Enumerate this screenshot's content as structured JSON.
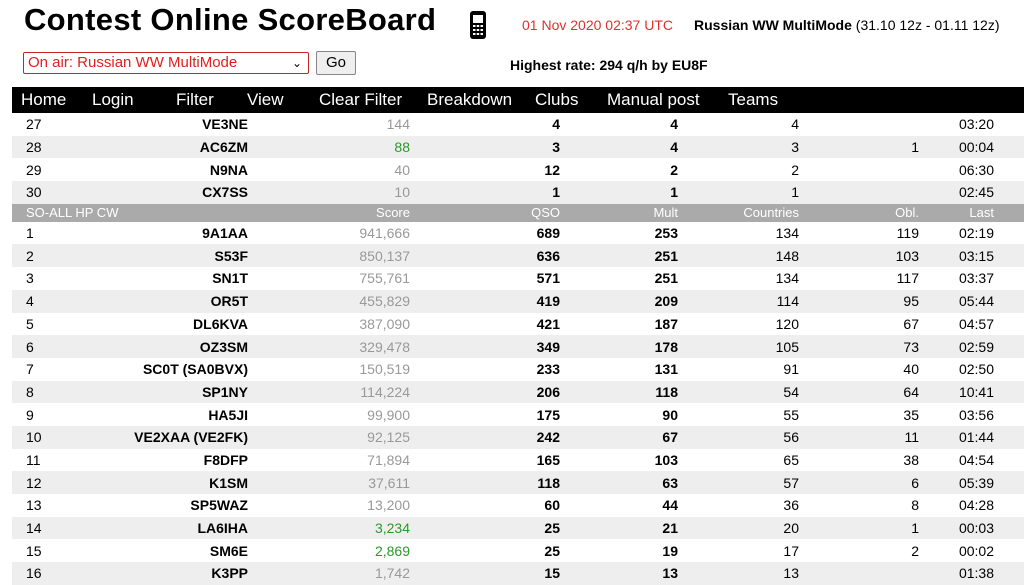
{
  "header": {
    "title": "Contest Online ScoreBoard",
    "datetime": "01 Nov 2020 02:37 UTC",
    "contest_name": "Russian WW MultiMode",
    "contest_period": " (31.10 12z - 01.11 12z)",
    "select_value": "On air: Russian WW MultiMode",
    "go_label": "Go",
    "highest_rate": "Highest rate: 294 q/h by EU8F"
  },
  "nav": [
    "Home",
    "Login",
    "Filter",
    "View",
    "Clear Filter",
    "Breakdown",
    "Clubs",
    "Manual post",
    "Teams"
  ],
  "top_rows": [
    {
      "rank": "27",
      "call": "VE3NE",
      "score": "144",
      "qso": "4",
      "mult": "4",
      "countries": "4",
      "obl": "",
      "last": "03:20",
      "green": false
    },
    {
      "rank": "28",
      "call": "AC6ZM",
      "score": "88",
      "qso": "3",
      "mult": "4",
      "countries": "3",
      "obl": "1",
      "last": "00:04",
      "green": true
    },
    {
      "rank": "29",
      "call": "N9NA",
      "score": "40",
      "qso": "12",
      "mult": "2",
      "countries": "2",
      "obl": "",
      "last": "06:30",
      "green": false
    },
    {
      "rank": "30",
      "call": "CX7SS",
      "score": "10",
      "qso": "1",
      "mult": "1",
      "countries": "1",
      "obl": "",
      "last": "02:45",
      "green": false
    }
  ],
  "section": {
    "category": "SO-ALL HP CW",
    "col_score": "Score",
    "col_qso": "QSO",
    "col_mult": "Mult",
    "col_countries": "Countries",
    "col_obl": "Obl.",
    "col_last": "Last"
  },
  "rows": [
    {
      "rank": "1",
      "call": "9A1AA",
      "score": "941,666",
      "qso": "689",
      "mult": "253",
      "countries": "134",
      "obl": "119",
      "last": "02:19",
      "green": false
    },
    {
      "rank": "2",
      "call": "S53F",
      "score": "850,137",
      "qso": "636",
      "mult": "251",
      "countries": "148",
      "obl": "103",
      "last": "03:15",
      "green": false
    },
    {
      "rank": "3",
      "call": "SN1T",
      "score": "755,761",
      "qso": "571",
      "mult": "251",
      "countries": "134",
      "obl": "117",
      "last": "03:37",
      "green": false
    },
    {
      "rank": "4",
      "call": "OR5T",
      "score": "455,829",
      "qso": "419",
      "mult": "209",
      "countries": "114",
      "obl": "95",
      "last": "05:44",
      "green": false
    },
    {
      "rank": "5",
      "call": "DL6KVA",
      "score": "387,090",
      "qso": "421",
      "mult": "187",
      "countries": "120",
      "obl": "67",
      "last": "04:57",
      "green": false
    },
    {
      "rank": "6",
      "call": "OZ3SM",
      "score": "329,478",
      "qso": "349",
      "mult": "178",
      "countries": "105",
      "obl": "73",
      "last": "02:59",
      "green": false
    },
    {
      "rank": "7",
      "call": "SC0T (SA0BVX)",
      "score": "150,519",
      "qso": "233",
      "mult": "131",
      "countries": "91",
      "obl": "40",
      "last": "02:50",
      "green": false
    },
    {
      "rank": "8",
      "call": "SP1NY",
      "score": "114,224",
      "qso": "206",
      "mult": "118",
      "countries": "54",
      "obl": "64",
      "last": "10:41",
      "green": false
    },
    {
      "rank": "9",
      "call": "HA5JI",
      "score": "99,900",
      "qso": "175",
      "mult": "90",
      "countries": "55",
      "obl": "35",
      "last": "03:56",
      "green": false
    },
    {
      "rank": "10",
      "call": "VE2XAA (VE2FK)",
      "score": "92,125",
      "qso": "242",
      "mult": "67",
      "countries": "56",
      "obl": "11",
      "last": "01:44",
      "green": false
    },
    {
      "rank": "11",
      "call": "F8DFP",
      "score": "71,894",
      "qso": "165",
      "mult": "103",
      "countries": "65",
      "obl": "38",
      "last": "04:54",
      "green": false
    },
    {
      "rank": "12",
      "call": "K1SM",
      "score": "37,611",
      "qso": "118",
      "mult": "63",
      "countries": "57",
      "obl": "6",
      "last": "05:39",
      "green": false
    },
    {
      "rank": "13",
      "call": "SP5WAZ",
      "score": "13,200",
      "qso": "60",
      "mult": "44",
      "countries": "36",
      "obl": "8",
      "last": "04:28",
      "green": false
    },
    {
      "rank": "14",
      "call": "LA6IHA",
      "score": "3,234",
      "qso": "25",
      "mult": "21",
      "countries": "20",
      "obl": "1",
      "last": "00:03",
      "green": true
    },
    {
      "rank": "15",
      "call": "SM6E",
      "score": "2,869",
      "qso": "25",
      "mult": "19",
      "countries": "17",
      "obl": "2",
      "last": "00:02",
      "green": true
    },
    {
      "rank": "16",
      "call": "K3PP",
      "score": "1,742",
      "qso": "15",
      "mult": "13",
      "countries": "13",
      "obl": "",
      "last": "01:38",
      "green": false
    }
  ],
  "colors": {
    "accent_red": "#e03030",
    "green_score": "#2a9a2a",
    "header_gray": "#aaaaaa",
    "alt_row": "#eeeeee"
  }
}
